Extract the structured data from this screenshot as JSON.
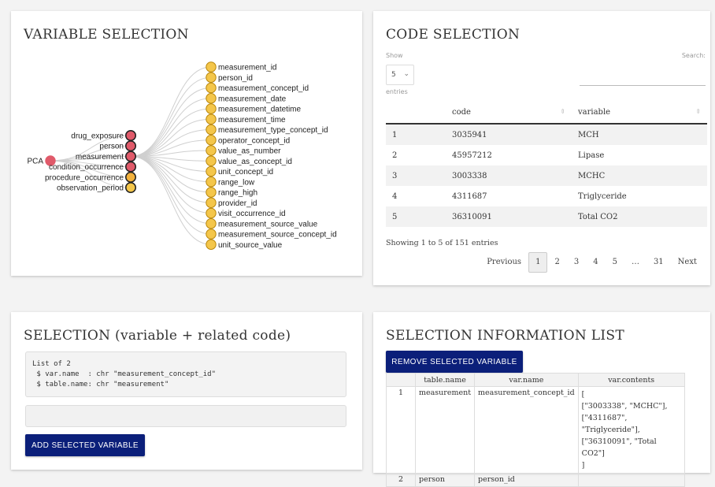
{
  "variable_panel": {
    "title": "VARIABLE SELECTION",
    "root": "PCA",
    "tables": [
      "drug_exposure",
      "person",
      "measurement",
      "condition_occurrence",
      "procedure_occurrence",
      "observation_period"
    ],
    "fields": [
      "measurement_id",
      "person_id",
      "measurement_concept_id",
      "measurement_date",
      "measurement_datetime",
      "measurement_time",
      "measurement_type_concept_id",
      "operator_concept_id",
      "value_as_number",
      "value_as_concept_id",
      "unit_concept_id",
      "range_low",
      "range_high",
      "provider_id",
      "visit_occurrence_id",
      "measurement_source_value",
      "measurement_source_concept_id",
      "unit_source_value"
    ],
    "colors": {
      "root": "#e05a6a",
      "red_node": "#e05a6a",
      "orange_node": "#f2b13c",
      "yellow_node": "#f4c64a",
      "node_stroke": "#222",
      "edge": "#cfcfcf"
    }
  },
  "code_panel": {
    "title": "CODE SELECTION",
    "show_label": "Show",
    "entries_value": "5",
    "entries_label": "entries",
    "search_label": "Search:",
    "columns": [
      "",
      "code",
      "variable"
    ],
    "rows": [
      {
        "idx": "1",
        "code": "3035941",
        "variable": "MCH"
      },
      {
        "idx": "2",
        "code": "45957212",
        "variable": "Lipase"
      },
      {
        "idx": "3",
        "code": "3003338",
        "variable": "MCHC"
      },
      {
        "idx": "4",
        "code": "4311687",
        "variable": "Triglyceride"
      },
      {
        "idx": "5",
        "code": "36310091",
        "variable": "Total CO2"
      }
    ],
    "info": "Showing 1 to 5 of 151 entries",
    "pager": {
      "previous": "Previous",
      "pages": [
        "1",
        "2",
        "3",
        "4",
        "5",
        "…",
        "31"
      ],
      "next": "Next",
      "active": "1"
    }
  },
  "selection_panel": {
    "title": "SELECTION (variable + related code)",
    "code_lines": [
      "List of 2",
      " $ var.name  : chr \"measurement_concept_id\"",
      " $ table.name: chr \"measurement\""
    ],
    "button": "ADD SELECTED VARIABLE"
  },
  "info_panel": {
    "title": "SELECTION INFORMATION LIST",
    "button": "REMOVE SELECTED VARIABLE",
    "columns": [
      "",
      "table.name",
      "var.name",
      "var.contents"
    ],
    "rows": [
      {
        "idx": "1",
        "table": "measurement",
        "var": "measurement_concept_id",
        "contents": [
          "[",
          "[\"3003338\", \"MCHC\"],",
          "[\"4311687\", \"Triglyceride\"],",
          "[\"36310091\", \"Total CO2\"]",
          "]"
        ]
      },
      {
        "idx": "2",
        "table": "person",
        "var": "person_id",
        "contents": []
      }
    ],
    "colors": {
      "button_bg": "#0b1f7a"
    }
  }
}
